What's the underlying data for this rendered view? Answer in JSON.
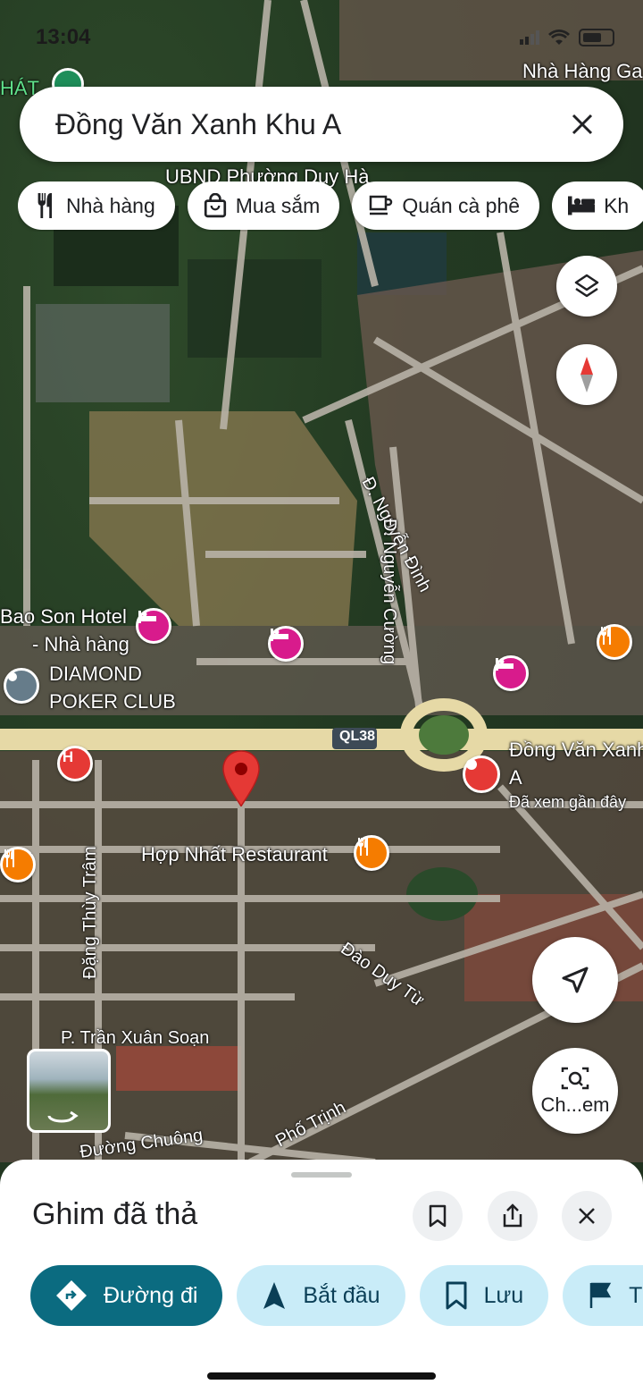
{
  "status_bar": {
    "time": "13:04"
  },
  "search": {
    "query": "Đồng Văn Xanh Khu A"
  },
  "chips": [
    {
      "label": "Nhà hàng",
      "icon": "restaurant-icon"
    },
    {
      "label": "Mua sắm",
      "icon": "shopping-bag-icon"
    },
    {
      "label": "Quán cà phê",
      "icon": "coffee-icon"
    },
    {
      "label": "Kh",
      "icon": "hotel-icon"
    }
  ],
  "map_labels": {
    "top_right": "Nhà Hàng Ga",
    "top_left": "HÁT",
    "ubnd": "UBND Phường Duy Hà",
    "nguyen_dinh": "Đ. Nguyễn Đình",
    "nguyen_cuong": "Đ. Nguyễn Cường",
    "bao_son_1": "Bao Son Hotel",
    "bao_son_2": "- Nhà hàng",
    "diamond_1": "DIAMOND",
    "diamond_2": "POKER CLUB",
    "ql38": "QL38",
    "dongvan_1": "Đồng Văn Xanh",
    "dongvan_2": "A",
    "dongvan_sub": "Đã xem gần đây",
    "hop_nhat": "Hợp Nhất Restaurant",
    "dang_thuy_tram": "Đặng Thùy Trâm",
    "dao_duy_tu": "Đào Duy Từ",
    "tran_xuan_soan": "P. Trần Xuân Soạn",
    "duong_chuong": "Đường Chuông",
    "pho_trinh": "Phố Trịnh"
  },
  "lens_button": {
    "label": "Ch...em"
  },
  "sheet": {
    "title": "Ghim đã thả",
    "actions": [
      {
        "label": "Đường đi",
        "icon": "directions-icon"
      },
      {
        "label": "Bắt đầu",
        "icon": "navigation-arrow-icon"
      },
      {
        "label": "Lưu",
        "icon": "bookmark-icon"
      },
      {
        "label": "Th",
        "icon": "flag-icon"
      }
    ]
  },
  "colors": {
    "primary": "#0b6b80",
    "secondary_action": "#c9ecf8",
    "hotel": "#d81b8c",
    "restaurant": "#f57c00",
    "pin": "#e53935"
  }
}
